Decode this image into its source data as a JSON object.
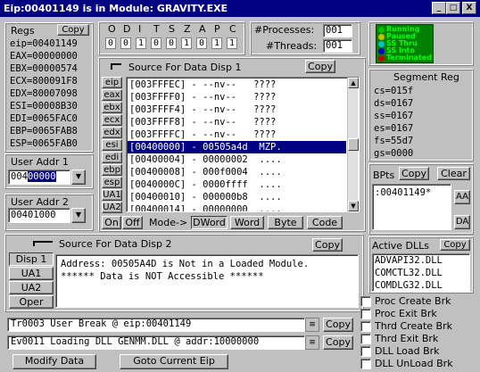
{
  "window": {
    "title": "Eip:00401149 is in Module: GRAVITY.EXE",
    "min_glyph": "_",
    "max_glyph": "□",
    "close_glyph": "X"
  },
  "regs": {
    "label": "Regs",
    "copy_label": "Copy",
    "items": [
      "eip=00401149",
      "EAX=00000000",
      "EBX=00000574",
      "ECX=800091F8",
      "EDX=80007098",
      "ESI=00008B30",
      "EDI=0065FAC0",
      "EBP=0065FAB8",
      "ESP=0065FAB0"
    ]
  },
  "user_addr1": {
    "label": "User Addr 1",
    "value_prefix": "004",
    "value_selected": "00000"
  },
  "user_addr2": {
    "label": "User Addr 2",
    "value": "00401000"
  },
  "flags": {
    "letters": [
      "O",
      "D",
      "I",
      "T",
      "S",
      "Z",
      "A",
      "P",
      "C"
    ],
    "values": [
      "0",
      "0",
      "1",
      "0",
      "0",
      "1",
      "0",
      "1",
      "1"
    ]
  },
  "counts": {
    "processes_label": "#Processes:",
    "processes_value": "001",
    "threads_label": "#Threads:",
    "threads_value": "001"
  },
  "legend": {
    "items": [
      "Running",
      "Paused",
      "SS Thru",
      "SS Into",
      "Terminated"
    ]
  },
  "disp1": {
    "label": "Source For Data Disp 1",
    "copy_label": "Copy",
    "reg_buttons": [
      "eip",
      "eax",
      "ebx",
      "ecx",
      "edx",
      "esi",
      "edi",
      "ebp",
      "esp",
      "UA1",
      "UA2"
    ],
    "rows": [
      "[003FFFEC] - --nv--   ????",
      "[003FFFF0] - --nv--   ????",
      "[003FFFF4] - --nv--   ????",
      "[003FFFF8] - --nv--   ????",
      "[003FFFFC] - --nv--   ????",
      "[00400000] - 00505a4d  MZP.",
      "[00400004] - 00000002  ....",
      "[00400008] - 000f0004  ....",
      "[0040000C] - 0000ffff  ....",
      "[00400010] - 000000b8  ....",
      "[00400014] - 00000000  ...."
    ],
    "selected_index": 5,
    "on_label": "On",
    "off_label": "Off",
    "mode_label": "Mode->",
    "modes": [
      "DWord",
      "Word",
      "Byte",
      "Code"
    ]
  },
  "segment": {
    "label": "Segment Reg",
    "items": [
      "cs=015f",
      "ds=0167",
      "ss=0167",
      "es=0167",
      "fs=55d7",
      "gs=0000"
    ]
  },
  "bpts": {
    "label": "BPts",
    "copy_label": "Copy",
    "clear_label": "Clear",
    "items": [
      ":00401149*"
    ],
    "aa_label": "AA",
    "da_label": "DA"
  },
  "disp2": {
    "label": "Source For Data Disp 2",
    "copy_label": "Copy",
    "buttons": [
      "Disp 1",
      "UA1",
      "UA2",
      "Oper"
    ],
    "lines": [
      "Address: 00505A4D is Not in a Loaded Module.",
      "****** Data is NOT Accessible ******"
    ]
  },
  "dlls": {
    "label": "Active DLLs",
    "copy_label": "Copy",
    "items": [
      "ADVAPI32.DLL",
      "COMCTL32.DLL",
      "COMDLG32.DLL"
    ]
  },
  "status": {
    "line1": "Tr0003 User Break @ eip:00401149",
    "line2": "Ev0011 Loading DLL GENMM.DLL @ addr:10000000",
    "copy_label": "Copy"
  },
  "bottom": {
    "modify_label": "Modify Data",
    "goto_label": "Goto Current Eip"
  },
  "breaks": {
    "items": [
      "Proc Create Brk",
      "Proc Exit Brk",
      "Thrd Create Brk",
      "Thrd Exit Brk",
      "DLL Load Brk",
      "DLL UnLoad Brk"
    ]
  }
}
